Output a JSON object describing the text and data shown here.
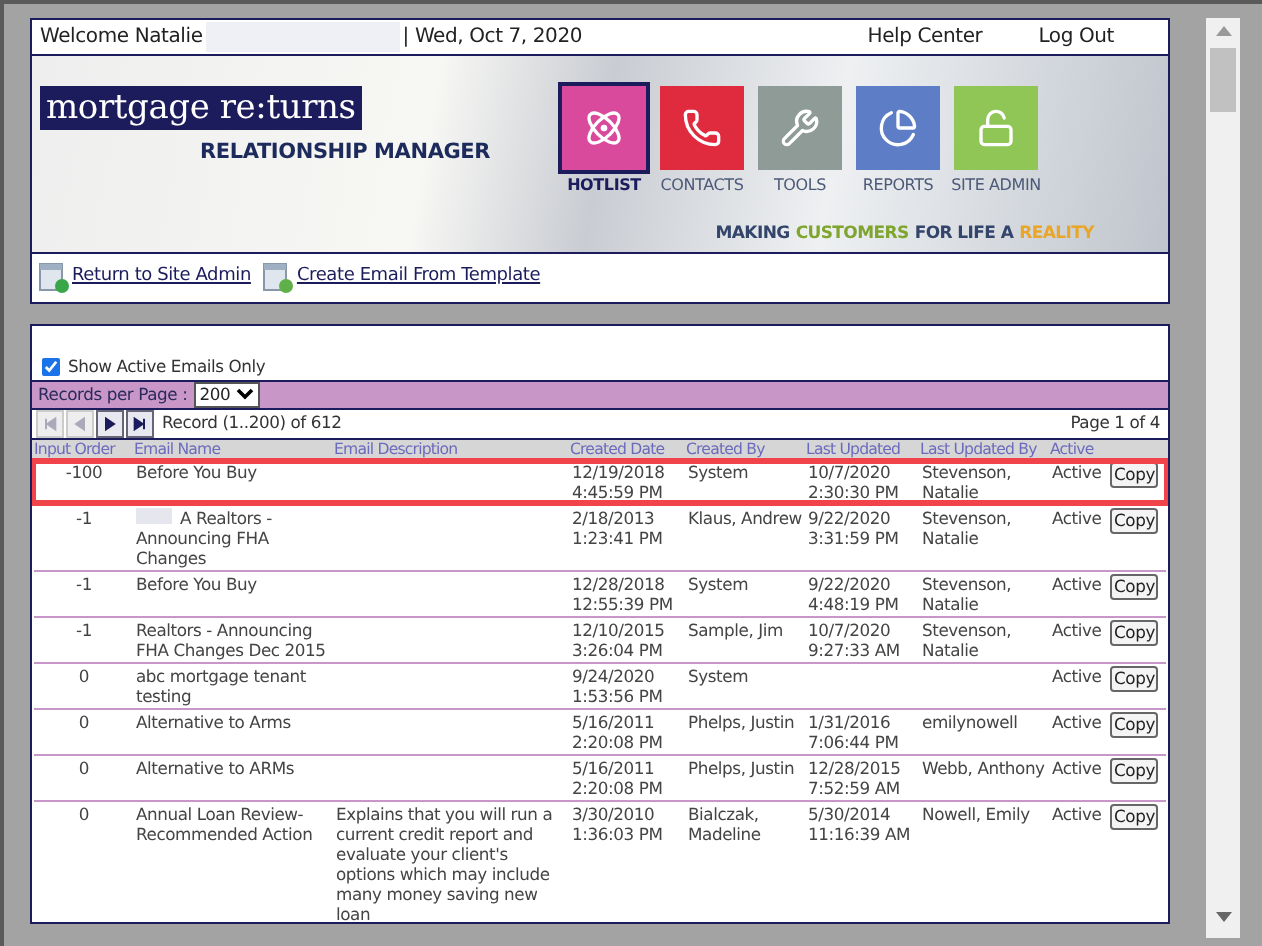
{
  "top_bar": {
    "welcome": "Welcome Natalie",
    "date": "| Wed, Oct 7, 2020",
    "links": [
      "Help Center",
      "Log Out"
    ]
  },
  "banner": {
    "logo": "mortgage re:turns",
    "subtitle": "RELATIONSHIP MANAGER",
    "nav": [
      {
        "label": "HOTLIST",
        "kind": "atom",
        "color": "#d94a9c",
        "selected": true
      },
      {
        "label": "CONTACTS",
        "kind": "phone",
        "color": "#e02b3f",
        "selected": false
      },
      {
        "label": "TOOLS",
        "kind": "tools",
        "color": "#8e9b97",
        "selected": false
      },
      {
        "label": "REPORTS",
        "kind": "pie",
        "color": "#5d7ec6",
        "selected": false
      },
      {
        "label": "SITE ADMIN",
        "kind": "lock",
        "color": "#8fc655",
        "selected": false
      }
    ],
    "tagline": [
      {
        "text": "MAKING",
        "color": "#34456b"
      },
      {
        "text": "CUSTOMERS",
        "color": "#7fa52f"
      },
      {
        "text": "FOR LIFE A",
        "color": "#34456b"
      },
      {
        "text": "REALITY",
        "color": "#e9a628"
      }
    ]
  },
  "actions": [
    "Return to Site Admin",
    "Create Email From Template"
  ],
  "filter": {
    "label": "Show Active Emails Only",
    "checked": true
  },
  "records_per_page": {
    "label": "Records per Page :",
    "value": "200"
  },
  "pager": {
    "buttons": [
      {
        "kind": "first",
        "disabled": true
      },
      {
        "kind": "prev",
        "disabled": true
      },
      {
        "kind": "next",
        "disabled": false
      },
      {
        "kind": "last",
        "disabled": false
      }
    ],
    "record": "Record (1..200) of 612",
    "page": "Page 1 of 4"
  },
  "table": {
    "columns": [
      "Input Order",
      "Email Name",
      "Email Description",
      "Created Date",
      "Created By",
      "Last Updated",
      "Last Updated By",
      "Active"
    ],
    "rows": [
      {
        "order": "-100",
        "name": "Before You Buy",
        "description": "",
        "created": "12/19/2018 4:45:59 PM",
        "created_by": "System",
        "updated": "10/7/2020 2:30:30 PM",
        "updated_by": "Stevenson, Natalie",
        "active": "Active",
        "action": "Copy",
        "highlighted": true,
        "redacted": false
      },
      {
        "order": "-1",
        "name": "A Realtors - Announcing FHA Changes",
        "description": "",
        "created": "2/18/2013 1:23:41 PM",
        "created_by": "Klaus, Andrew",
        "updated": "9/22/2020 3:31:59 PM",
        "updated_by": "Stevenson, Natalie",
        "active": "Active",
        "action": "Copy",
        "highlighted": false,
        "redacted": true
      },
      {
        "order": "-1",
        "name": "Before You Buy",
        "description": "",
        "created": "12/28/2018 12:55:39 PM",
        "created_by": "System",
        "updated": "9/22/2020 4:48:19 PM",
        "updated_by": "Stevenson, Natalie",
        "active": "Active",
        "action": "Copy",
        "highlighted": false,
        "redacted": false
      },
      {
        "order": "-1",
        "name": "Realtors - Announcing FHA Changes Dec 2015",
        "description": "",
        "created": "12/10/2015 3:26:04 PM",
        "created_by": "Sample, Jim",
        "updated": "10/7/2020 9:27:33 AM",
        "updated_by": "Stevenson, Natalie",
        "active": "Active",
        "action": "Copy",
        "highlighted": false,
        "redacted": false
      },
      {
        "order": "0",
        "name": "abc mortgage tenant testing",
        "description": "",
        "created": "9/24/2020 1:53:56 PM",
        "created_by": "System",
        "updated": "",
        "updated_by": "",
        "active": "Active",
        "action": "Copy",
        "highlighted": false,
        "redacted": false
      },
      {
        "order": "0",
        "name": "Alternative to Arms",
        "description": "",
        "created": "5/16/2011 2:20:08 PM",
        "created_by": "Phelps, Justin",
        "updated": "1/31/2016 7:06:44 PM",
        "updated_by": "emilynowell",
        "active": "Active",
        "action": "Copy",
        "highlighted": false,
        "redacted": false
      },
      {
        "order": "0",
        "name": "Alternative to ARMs",
        "description": "",
        "created": "5/16/2011 2:20:08 PM",
        "created_by": "Phelps, Justin",
        "updated": "12/28/2015 7:52:59 AM",
        "updated_by": "Webb, Anthony",
        "active": "Active",
        "action": "Copy",
        "highlighted": false,
        "redacted": false
      },
      {
        "order": "0",
        "name": "Annual Loan Review-Recommended Action",
        "description": "Explains that you will run a current credit report and evaluate your client's options which may include many money saving new loan",
        "created": "3/30/2010 1:36:03 PM",
        "created_by": "Bialczak, Madeline",
        "updated": "5/30/2014 11:16:39 AM",
        "updated_by": "Nowell, Emily",
        "active": "Active",
        "action": "Copy",
        "highlighted": false,
        "redacted": false
      }
    ]
  }
}
